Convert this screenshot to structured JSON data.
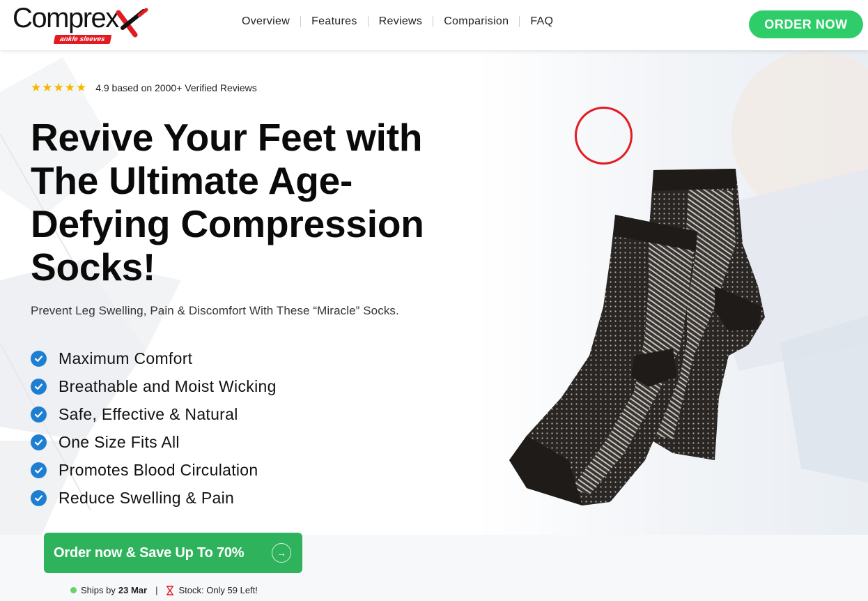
{
  "brand": {
    "name": "Comprex",
    "tagline": "ankle sleeves",
    "accent_color": "#e11b22"
  },
  "nav": {
    "items": [
      "Overview",
      "Features",
      "Reviews",
      "Comparision",
      "FAQ"
    ]
  },
  "header": {
    "order_button": "ORDER NOW",
    "order_button_color": "#2fcd6a"
  },
  "hero": {
    "stars_icon": "star-icon",
    "rating_text": "4.9 based on 2000+ Verified Reviews",
    "headline": "Revive Your Feet with The Ultimate Age-Defying Compression Socks!",
    "subhead": "Prevent Leg Swelling, Pain & Discomfort With These “Miracle” Socks.",
    "features": [
      "Maximum Comfort",
      "Breathable and Moist Wicking",
      "Safe, Effective & Natural",
      "One Size Fits All",
      "Promotes Blood Circulation",
      "Reduce Swelling & Pain"
    ],
    "check_color": "#1e7fd2"
  },
  "cta": {
    "label": "Order now & Save Up To 70%",
    "color": "#2eb25b",
    "arrow_icon": "arrow-right-icon"
  },
  "shipping": {
    "ships_prefix": "Ships by",
    "ships_date": "23 Mar",
    "separator": "|",
    "stock_text": "Stock: Only 59 Left!"
  }
}
